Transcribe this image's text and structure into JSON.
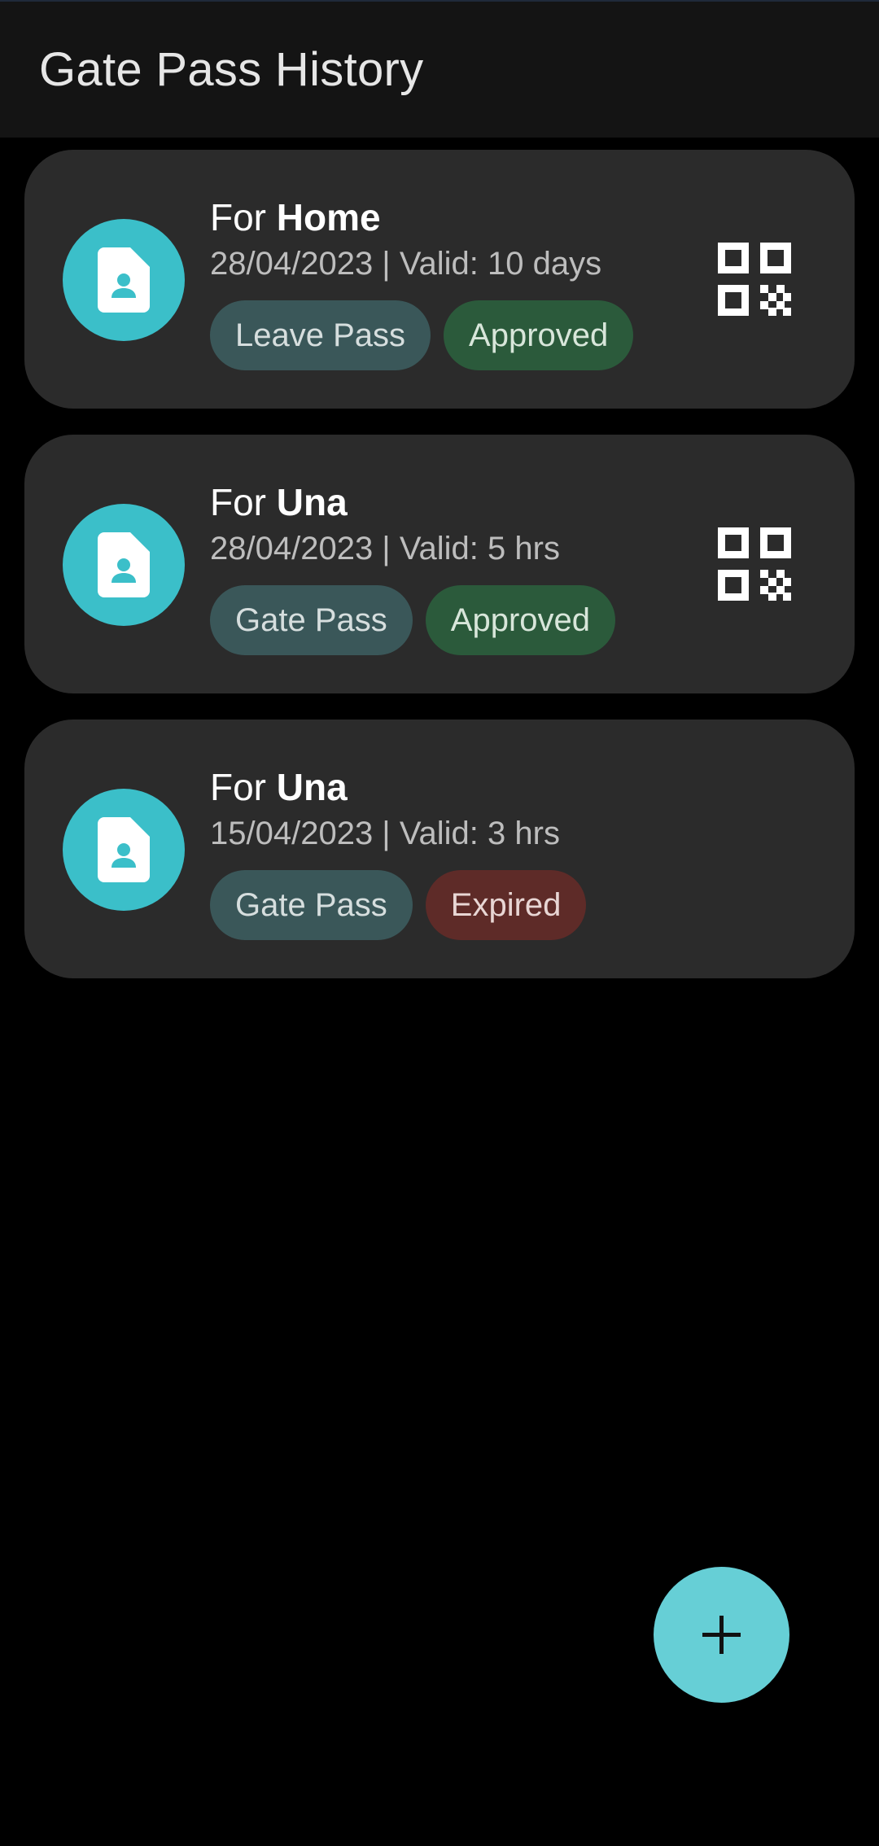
{
  "appbar": {
    "title": "Gate Pass History"
  },
  "passes": [
    {
      "prefix": "For",
      "destination": "Home",
      "date_validity": "28/04/2023 | Valid: 10 days",
      "type_label": "Leave Pass",
      "status_label": "Approved",
      "status": "approved",
      "has_qr": true
    },
    {
      "prefix": "For",
      "destination": "Una",
      "date_validity": "28/04/2023 | Valid: 5 hrs",
      "type_label": "Gate Pass",
      "status_label": "Approved",
      "status": "approved",
      "has_qr": true
    },
    {
      "prefix": "For",
      "destination": "Una",
      "date_validity": "15/04/2023 | Valid: 3 hrs",
      "type_label": "Gate Pass",
      "status_label": "Expired",
      "status": "expired",
      "has_qr": false
    }
  ],
  "icons": {
    "avatar": "contact-document-icon",
    "qr": "qr-code-icon",
    "fab": "plus-icon"
  },
  "colors": {
    "accent": "#3bbfc9",
    "fab": "#66cfd6",
    "approved_chip": "#2b5a3b",
    "expired_chip": "#5e2b28",
    "type_chip": "#3a5759"
  }
}
